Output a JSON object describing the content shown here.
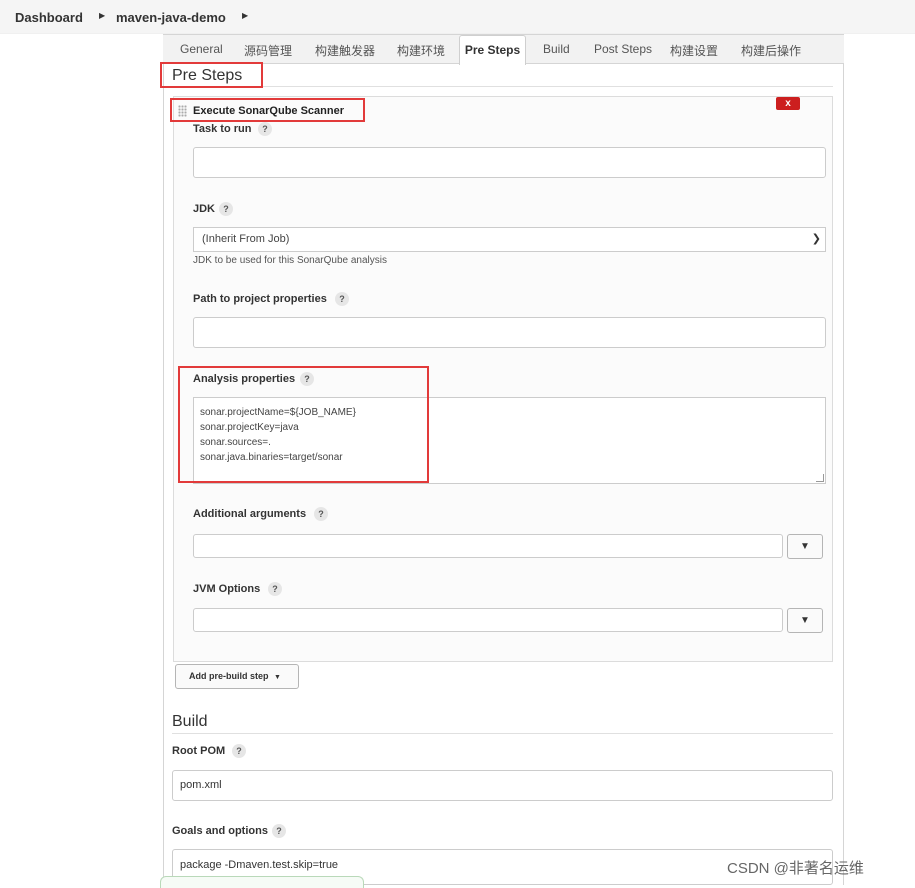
{
  "breadcrumb": {
    "items": [
      "Dashboard",
      "maven-java-demo"
    ]
  },
  "tabs": [
    "General",
    "源码管理",
    "构建触发器",
    "构建环境",
    "Pre Steps",
    "Build",
    "Post Steps",
    "构建设置",
    "构建后操作"
  ],
  "active_tab": "Pre Steps",
  "pre_steps": {
    "title": "Pre Steps",
    "builder": {
      "title": "Execute SonarQube Scanner",
      "delete_label": "x",
      "task_to_run": {
        "label": "Task to run",
        "value": ""
      },
      "jdk": {
        "label": "JDK",
        "selected": "(Inherit From Job)",
        "hint": "JDK to be used for this SonarQube analysis"
      },
      "path_to_project_properties": {
        "label": "Path to project properties",
        "value": ""
      },
      "analysis_properties": {
        "label": "Analysis properties",
        "lines": [
          "sonar.projectName=${JOB_NAME}",
          "sonar.projectKey=java",
          "sonar.sources=.",
          "sonar.java.binaries=target/sonar"
        ]
      },
      "additional_arguments": {
        "label": "Additional arguments",
        "value": ""
      },
      "jvm_options": {
        "label": "JVM Options",
        "value": ""
      }
    },
    "add_button": "Add pre-build step"
  },
  "build": {
    "title": "Build",
    "root_pom": {
      "label": "Root POM",
      "value": "pom.xml"
    },
    "goals": {
      "label": "Goals and options",
      "value": "package -Dmaven.test.skip=true"
    }
  },
  "help_glyph": "?",
  "dropdown_glyph": "▼",
  "watermark": "CSDN @非著名运维",
  "colors": {
    "highlight": "#e23a3a",
    "delete": "#cc1f1f"
  }
}
